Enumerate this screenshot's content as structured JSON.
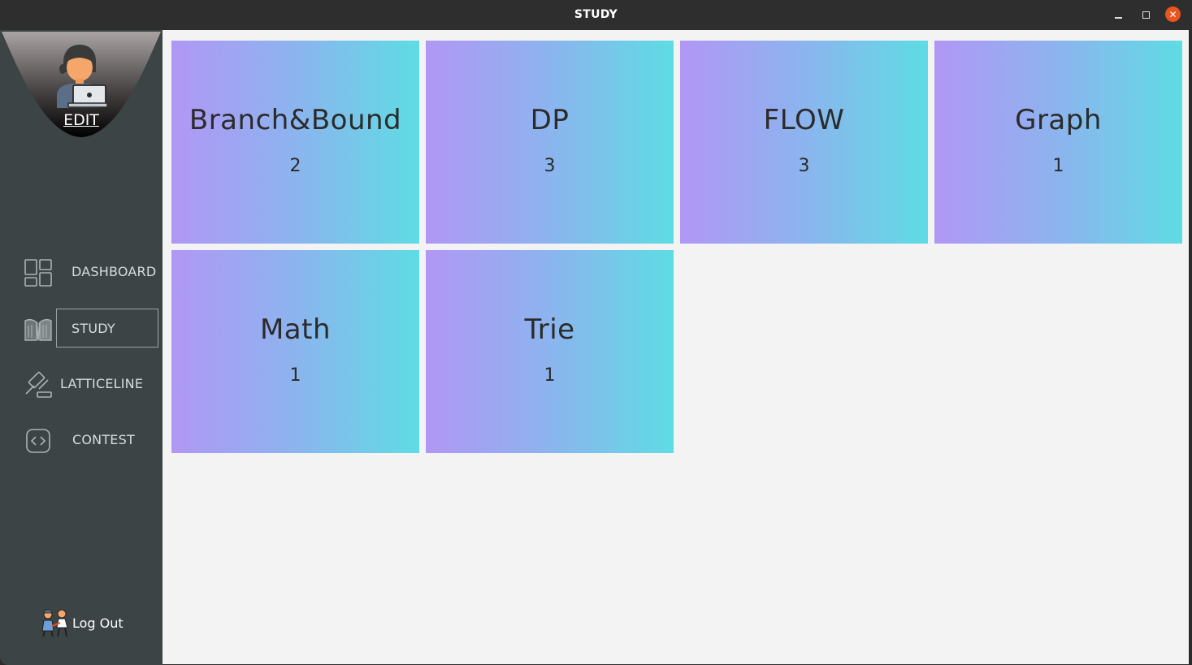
{
  "window": {
    "title": "STUDY",
    "controls": {
      "minimize": "minimize-icon",
      "maximize": "maximize-icon",
      "close": "close-icon",
      "close_glyph": "✕"
    }
  },
  "sidebar": {
    "edit_label": "EDIT",
    "nav": [
      {
        "label": "DASHBOARD",
        "icon": "dashboard-icon"
      },
      {
        "label": "STUDY",
        "icon": "book-icon",
        "active": true
      },
      {
        "label": "LATTICELINE",
        "icon": "gavel-icon"
      },
      {
        "label": "CONTEST",
        "icon": "code-icon"
      }
    ],
    "logout_label": "Log Out"
  },
  "topics": [
    {
      "name": "Branch&Bound",
      "count": "2"
    },
    {
      "name": "DP",
      "count": "3"
    },
    {
      "name": "FLOW",
      "count": "3"
    },
    {
      "name": "Graph",
      "count": "1"
    },
    {
      "name": "Math",
      "count": "1"
    },
    {
      "name": "Trie",
      "count": "1"
    }
  ],
  "colors": {
    "sidebar": "#3c4446",
    "content_bg": "#f3f3f3",
    "card_gradient_start": "#b197f5",
    "card_gradient_end": "#5edce4",
    "close_button": "#e95420"
  }
}
